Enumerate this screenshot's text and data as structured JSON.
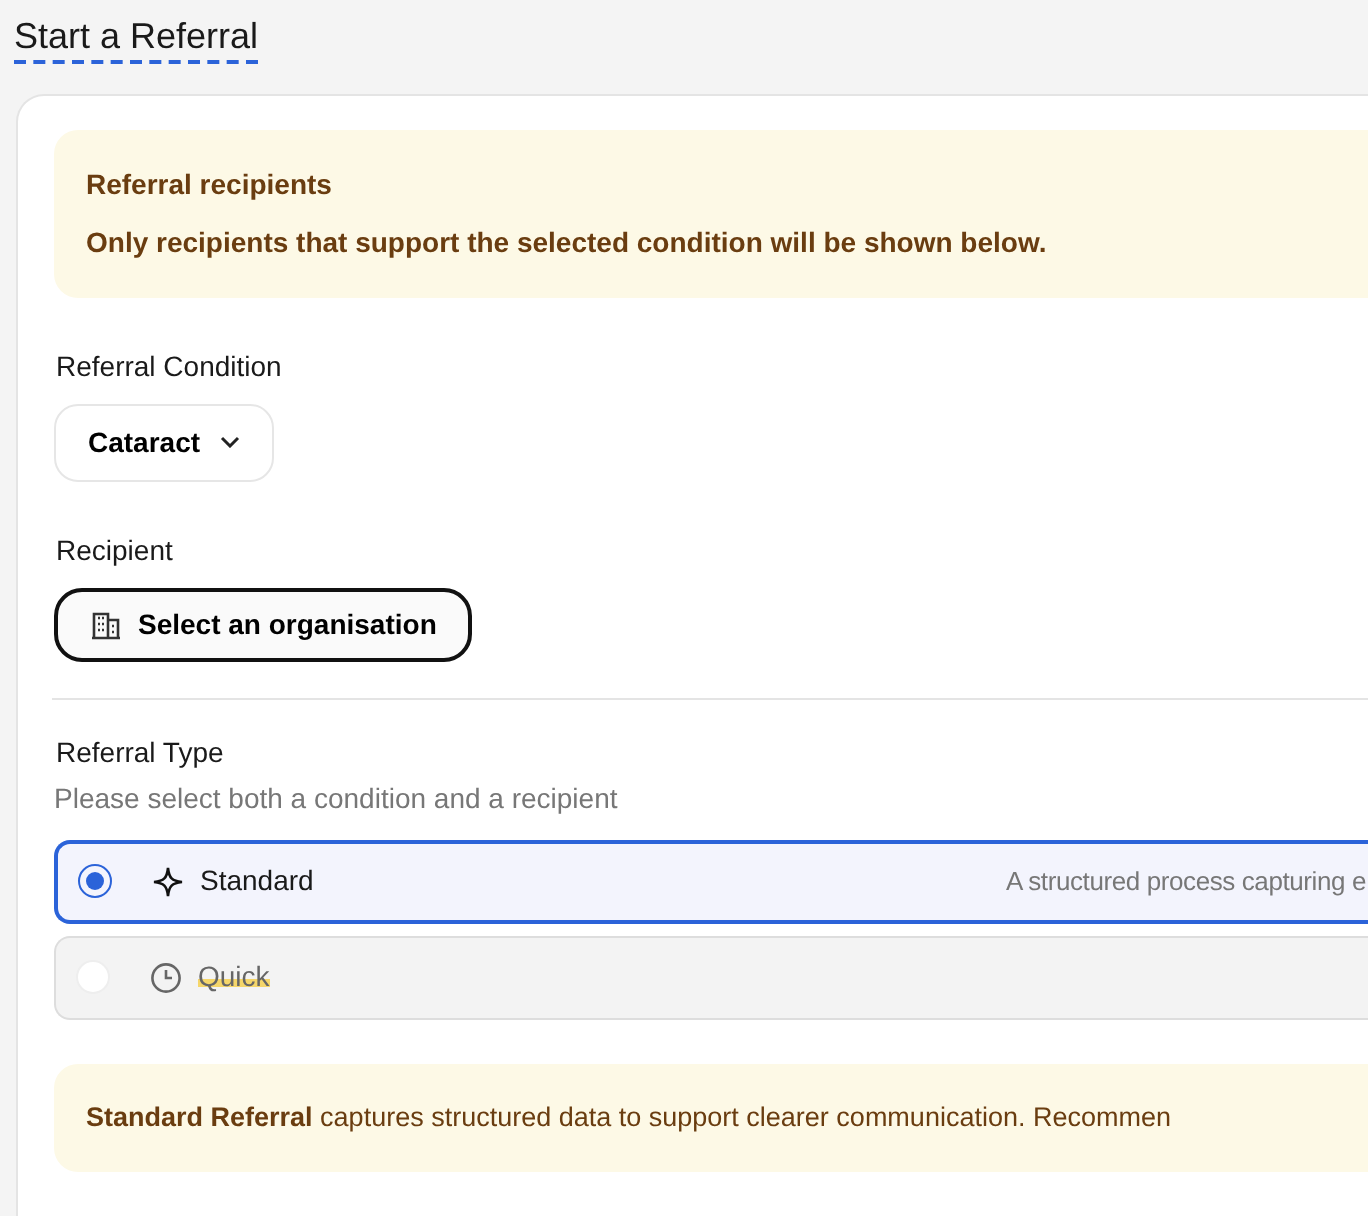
{
  "page_title": "Start a Referral",
  "info_banner": {
    "title": "Referral recipients",
    "text": "Only recipients that support the selected condition will be shown below."
  },
  "condition": {
    "label": "Referral Condition",
    "value": "Cataract"
  },
  "recipient": {
    "label": "Recipient",
    "button": "Select an organisation"
  },
  "referral_type": {
    "label": "Referral Type",
    "hint": "Please select both a condition and a recipient",
    "options": [
      {
        "label": "Standard",
        "description": "A structured process capturing e",
        "selected": true,
        "disabled": false,
        "kind": "sparkle"
      },
      {
        "label": "Quick",
        "selected": false,
        "disabled": true,
        "kind": "clock"
      }
    ]
  },
  "note_banner": {
    "text": "**Standard Referral** captures structured data to support clearer communication. Recommen"
  }
}
